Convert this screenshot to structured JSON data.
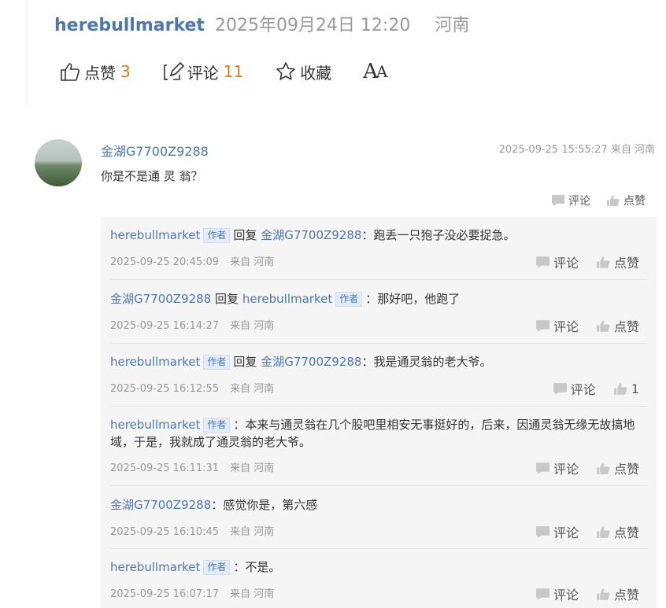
{
  "post": {
    "author": "herebullmarket",
    "time": "2025年09月24日 12:20",
    "location": "河南",
    "like_label": "点赞",
    "like_count": "3",
    "comment_label": "评论",
    "comment_count": "11",
    "fav_label": "收藏",
    "font_label_big": "A",
    "font_label_small": "A"
  },
  "comment": {
    "user": "金湖G7700Z9288",
    "time": "2025-09-25 15:55:27 来自 河南",
    "text": "你是不是通 灵 翁？",
    "comment_label": "评论",
    "like_label": "点赞"
  },
  "replies": [
    {
      "user": "herebullmarket",
      "is_author": true,
      "reply_word": "回复",
      "target": "金湖G7700Z9288",
      "target_is_author": false,
      "text": "：跑丢一只狍子没必要捉急。",
      "time": "2025-09-25 20:45:09",
      "from": "来自 河南",
      "comment_label": "评论",
      "like_label": "点赞"
    },
    {
      "user": "金湖G7700Z9288",
      "is_author": false,
      "reply_word": "回复",
      "target": "herebullmarket",
      "target_is_author": true,
      "text": "：那好吧，他跑了",
      "time": "2025-09-25 16:14:27",
      "from": "来自 河南",
      "comment_label": "评论",
      "like_label": "点赞"
    },
    {
      "user": "herebullmarket",
      "is_author": true,
      "reply_word": "回复",
      "target": "金湖G7700Z9288",
      "target_is_author": false,
      "text": "：我是通灵翁的老大爷。",
      "time": "2025-09-25 16:12:55",
      "from": "来自 河南",
      "comment_label": "评论",
      "like_label": "1"
    },
    {
      "user": "herebullmarket",
      "is_author": true,
      "reply_word": "",
      "target": "",
      "target_is_author": false,
      "text": "：本来与通灵翁在几个股吧里相安无事挺好的，后来，因通灵翁无缘无故搞地域，于是，我就成了通灵翁的老大爷。",
      "time": "2025-09-25 16:11:31",
      "from": "来自 河南",
      "comment_label": "评论",
      "like_label": "点赞"
    },
    {
      "user": "金湖G7700Z9288",
      "is_author": false,
      "reply_word": "",
      "target": "",
      "target_is_author": false,
      "text": "：感觉你是，第六感",
      "time": "2025-09-25 16:10:45",
      "from": "来自 河南",
      "comment_label": "评论",
      "like_label": "点赞"
    },
    {
      "user": "herebullmarket",
      "is_author": true,
      "reply_word": "",
      "target": "",
      "target_is_author": false,
      "text": "：不是。",
      "time": "2025-09-25 16:07:17",
      "from": "来自 河南",
      "comment_label": "评论",
      "like_label": "点赞"
    }
  ],
  "author_tag": "作者",
  "colors": {
    "link": "#4c77b2",
    "count": "#e07a1a",
    "reply_bg": "#f5f5f5"
  },
  "icons": [
    "thumbs-up-icon",
    "edit-comment-icon",
    "star-icon",
    "font-size-icon",
    "comment-bubble-icon",
    "like-icon"
  ]
}
